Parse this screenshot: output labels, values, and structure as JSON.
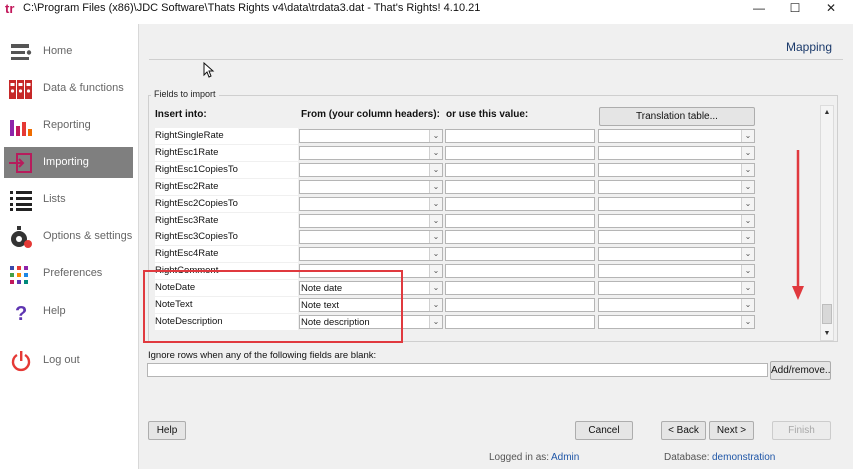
{
  "window": {
    "title": "C:\\Program Files (x86)\\JDC Software\\Thats Rights v4\\data\\trdata3.dat - That's Rights! 4.10.21",
    "app_icon_glyph": "tr",
    "controls": {
      "minimize": "—",
      "maximize": "☐",
      "close": "✕"
    }
  },
  "sidebar": {
    "items": [
      {
        "label": "Home",
        "icon": "home-icon"
      },
      {
        "label": "Data & functions",
        "icon": "binders-icon"
      },
      {
        "label": "Reporting",
        "icon": "bar-chart-icon"
      },
      {
        "label": "Importing",
        "icon": "import-icon",
        "active": true
      },
      {
        "label": "Lists",
        "icon": "list-icon"
      },
      {
        "label": "Options & settings",
        "icon": "settings-timer-icon"
      },
      {
        "label": "Preferences",
        "icon": "dots-grid-icon"
      },
      {
        "label": "Help",
        "icon": "question-icon"
      },
      {
        "label": "Log out",
        "icon": "power-icon"
      }
    ]
  },
  "main": {
    "section_title": "Mapping",
    "group_label": "Fields to import",
    "headers": {
      "insert_into": "Insert into:",
      "from": "From (your column headers):",
      "or_value": "or use this value:"
    },
    "translation_button": "Translation table...",
    "rows": [
      {
        "name": "RightSingleRate",
        "from": ""
      },
      {
        "name": "RightEsc1Rate",
        "from": ""
      },
      {
        "name": "RightEsc1CopiesTo",
        "from": ""
      },
      {
        "name": "RightEsc2Rate",
        "from": ""
      },
      {
        "name": "RightEsc2CopiesTo",
        "from": ""
      },
      {
        "name": "RightEsc3Rate",
        "from": ""
      },
      {
        "name": "RightEsc3CopiesTo",
        "from": ""
      },
      {
        "name": "RightEsc4Rate",
        "from": ""
      },
      {
        "name": "RightComment",
        "from": ""
      },
      {
        "name": "NoteDate",
        "from": "Note date"
      },
      {
        "name": "NoteText",
        "from": "Note text"
      },
      {
        "name": "NoteDescription",
        "from": "Note description"
      }
    ],
    "ignore_label": "Ignore rows when any of the following fields are blank:",
    "add_remove_button": "Add/remove..",
    "buttons": {
      "help": "Help",
      "cancel": "Cancel",
      "back": "< Back",
      "next": "Next >",
      "finish": "Finish"
    },
    "status": {
      "logged_in_label": "Logged in as:",
      "logged_in_user": "Admin",
      "database_label": "Database:",
      "database_name": "demonstration"
    }
  },
  "colors": {
    "active_nav": "#7f7f7f",
    "link": "#1f56a7",
    "annotation": "#e0393e",
    "panel_bg": "#f0f0f0"
  }
}
